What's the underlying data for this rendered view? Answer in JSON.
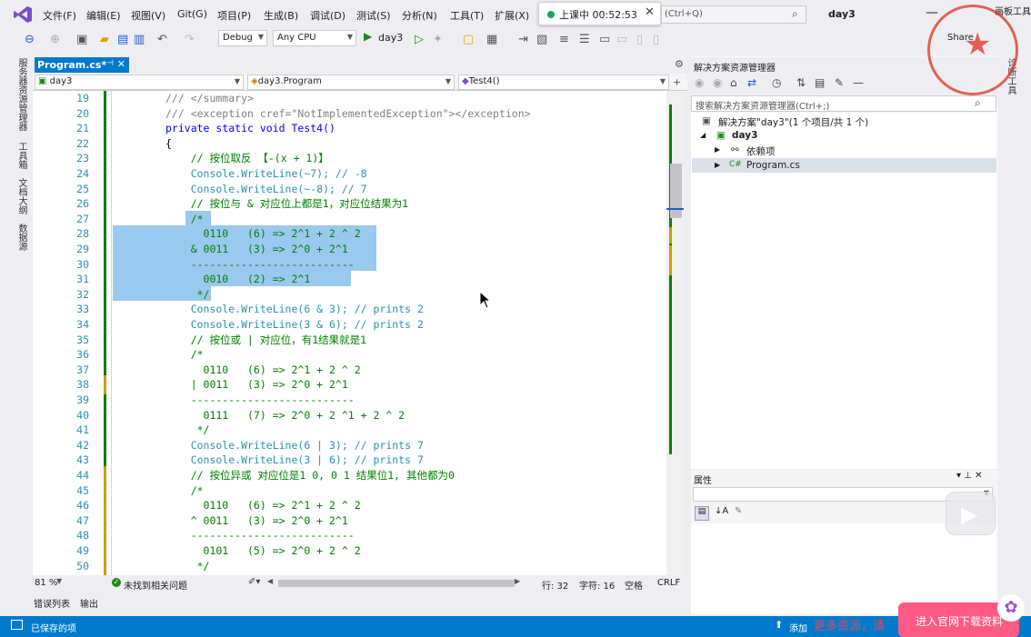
{
  "menu": {
    "items": [
      "文件(F)",
      "编辑(E)",
      "视图(V)",
      "Git(G)",
      "项目(P)",
      "生成(B)",
      "调试(D)",
      "测试(S)",
      "分析(N)",
      "工具(T)",
      "扩展(X)"
    ],
    "search_shortcut": "(Ctrl+Q)",
    "solution_title": "day3",
    "corner_label": "画板工具"
  },
  "timer": {
    "label": "上课中 00:52:53"
  },
  "toolbar": {
    "config": "Debug",
    "platform": "Any CPU",
    "run_label": "day3",
    "share_label": "Share"
  },
  "left_strip": [
    "服务器资源管理器",
    "工具箱",
    "文档大纲",
    "数据源"
  ],
  "editor": {
    "tab_label": "Program.cs*",
    "nav_project": "day3",
    "nav_class": "day3.Program",
    "nav_member": "Test4()",
    "lines": [
      {
        "n": "19",
        "text": "/// </summary>"
      },
      {
        "n": "20",
        "text": "/// <exception cref=\"NotImplementedException\"></exception>"
      },
      {
        "n": "21",
        "text": "private static void Test4()"
      },
      {
        "n": "22",
        "text": "{"
      },
      {
        "n": "23",
        "text": "    // 按位取反 【-(x + 1)】"
      },
      {
        "n": "24",
        "text": "    Console.WriteLine(~7); // -8"
      },
      {
        "n": "25",
        "text": "    Console.WriteLine(~-8); // 7"
      },
      {
        "n": "26",
        "text": "    // 按位与 & 对应位上都是1，对应位结果为1"
      },
      {
        "n": "27",
        "text": "    /*"
      },
      {
        "n": "28",
        "text": "      0110   (6) => 2^1 + 2 ^ 2"
      },
      {
        "n": "29",
        "text": "    & 0011   (3) => 2^0 + 2^1"
      },
      {
        "n": "30",
        "text": "    --------------------------"
      },
      {
        "n": "31",
        "text": "      0010   (2) => 2^1"
      },
      {
        "n": "32",
        "text": "     */"
      },
      {
        "n": "33",
        "text": "    Console.WriteLine(6 & 3); // prints 2"
      },
      {
        "n": "34",
        "text": "    Console.WriteLine(3 & 6); // prints 2"
      },
      {
        "n": "35",
        "text": "    // 按位或 | 对应位，有1结果就是1"
      },
      {
        "n": "36",
        "text": "    /*"
      },
      {
        "n": "37",
        "text": "      0110   (6) => 2^1 + 2 ^ 2"
      },
      {
        "n": "38",
        "text": "    | 0011   (3) => 2^0 + 2^1"
      },
      {
        "n": "39",
        "text": "    --------------------------"
      },
      {
        "n": "40",
        "text": "      0111   (7) => 2^0 + 2 ^1 + 2 ^ 2"
      },
      {
        "n": "41",
        "text": "     */"
      },
      {
        "n": "42",
        "text": "    Console.WriteLine(6 | 3); // prints 7"
      },
      {
        "n": "43",
        "text": "    Console.WriteLine(3 | 6); // prints 7"
      },
      {
        "n": "44",
        "text": "    // 按位异或 对应位是1 0, 0 1 结果位1, 其他都为0"
      },
      {
        "n": "45",
        "text": "    /*"
      },
      {
        "n": "46",
        "text": "      0110   (6) => 2^1 + 2 ^ 2"
      },
      {
        "n": "47",
        "text": "    ^ 0011   (3) => 2^0 + 2^1"
      },
      {
        "n": "48",
        "text": "    --------------------------"
      },
      {
        "n": "49",
        "text": "      0101   (5) => 2^0 + 2 ^ 2"
      },
      {
        "n": "50",
        "text": "     */"
      },
      {
        "n": "51",
        "text": ""
      }
    ]
  },
  "status_line": {
    "zoom": "81 %",
    "issues": "未找到相关问题",
    "row": "行: 32",
    "col": "字符: 16",
    "space": "空格",
    "eol": "CRLF"
  },
  "bottom_tabs": [
    "错误列表",
    "输出"
  ],
  "statusbar": {
    "saved": "已保存的项",
    "add": "添加"
  },
  "solution_explorer": {
    "title": "解决方案资源管理器",
    "search_placeholder": "搜索解决方案资源管理器(Ctrl+;)",
    "solution_node": "解决方案\"day3\"(1 个项目/共 1 个)",
    "project_node": "day3",
    "deps_node": "依赖项",
    "file_node": "Program.cs"
  },
  "properties": {
    "title": "属性"
  },
  "right_strip": "诊断工具",
  "overlay": {
    "promo_text": "更多资源，请",
    "promo_button": "进入官网下载资料"
  }
}
